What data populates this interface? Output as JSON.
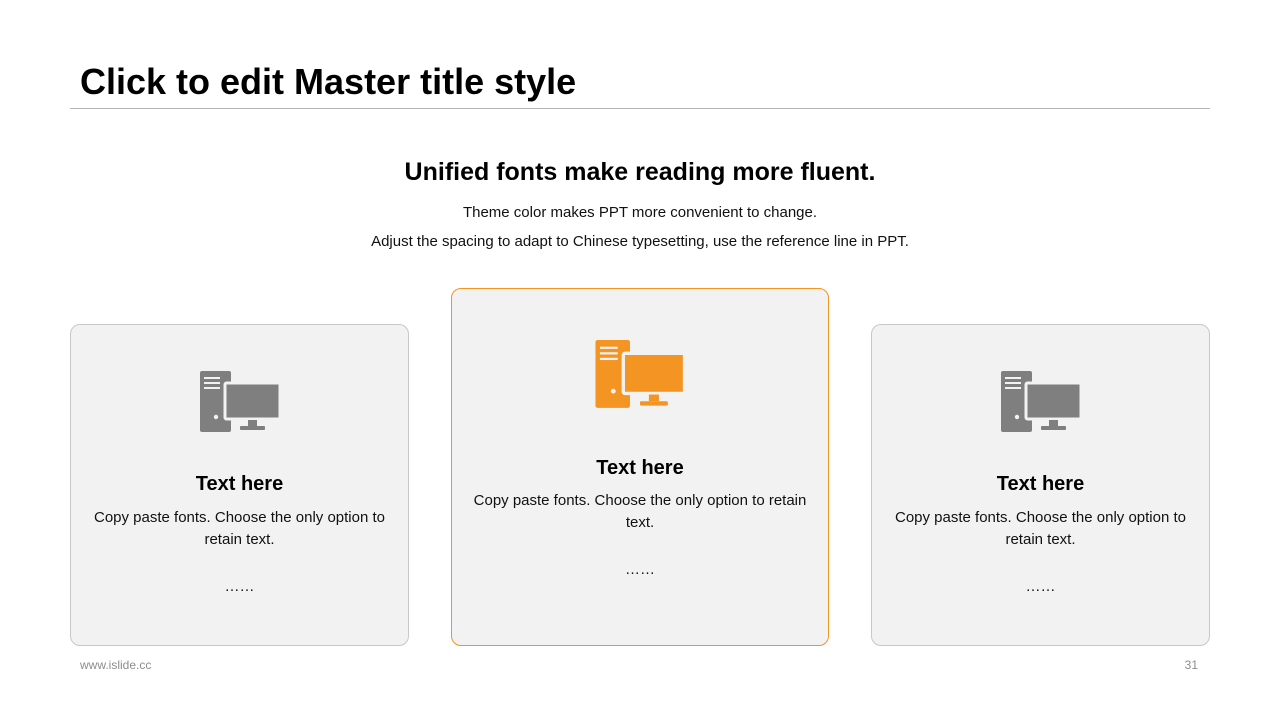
{
  "slide": {
    "title": "Click to edit Master title style",
    "subtitle": "Unified fonts make reading more fluent.",
    "desc_line1": "Theme color makes PPT more convenient to change.",
    "desc_line2": "Adjust the spacing to adapt to Chinese typesetting, use the reference line in PPT."
  },
  "cards": [
    {
      "icon": "computer-icon",
      "title": "Text here",
      "body": "Copy paste fonts. Choose the only option to retain text.",
      "ellipsis": "……",
      "color": "#7f7f7f"
    },
    {
      "icon": "computer-icon",
      "title": "Text here",
      "body": "Copy paste fonts. Choose the only option to retain text.",
      "ellipsis": "……",
      "color": "#f39423"
    },
    {
      "icon": "computer-icon",
      "title": "Text here",
      "body": "Copy paste fonts. Choose the only option to retain text.",
      "ellipsis": "……",
      "color": "#7f7f7f"
    }
  ],
  "footer": {
    "url": "www.islide.cc",
    "page_number": "31"
  },
  "colors": {
    "accent": "#f39423",
    "icon_gray": "#7f7f7f",
    "card_bg": "#f2f2f2",
    "card_border": "#c8c8c8"
  }
}
